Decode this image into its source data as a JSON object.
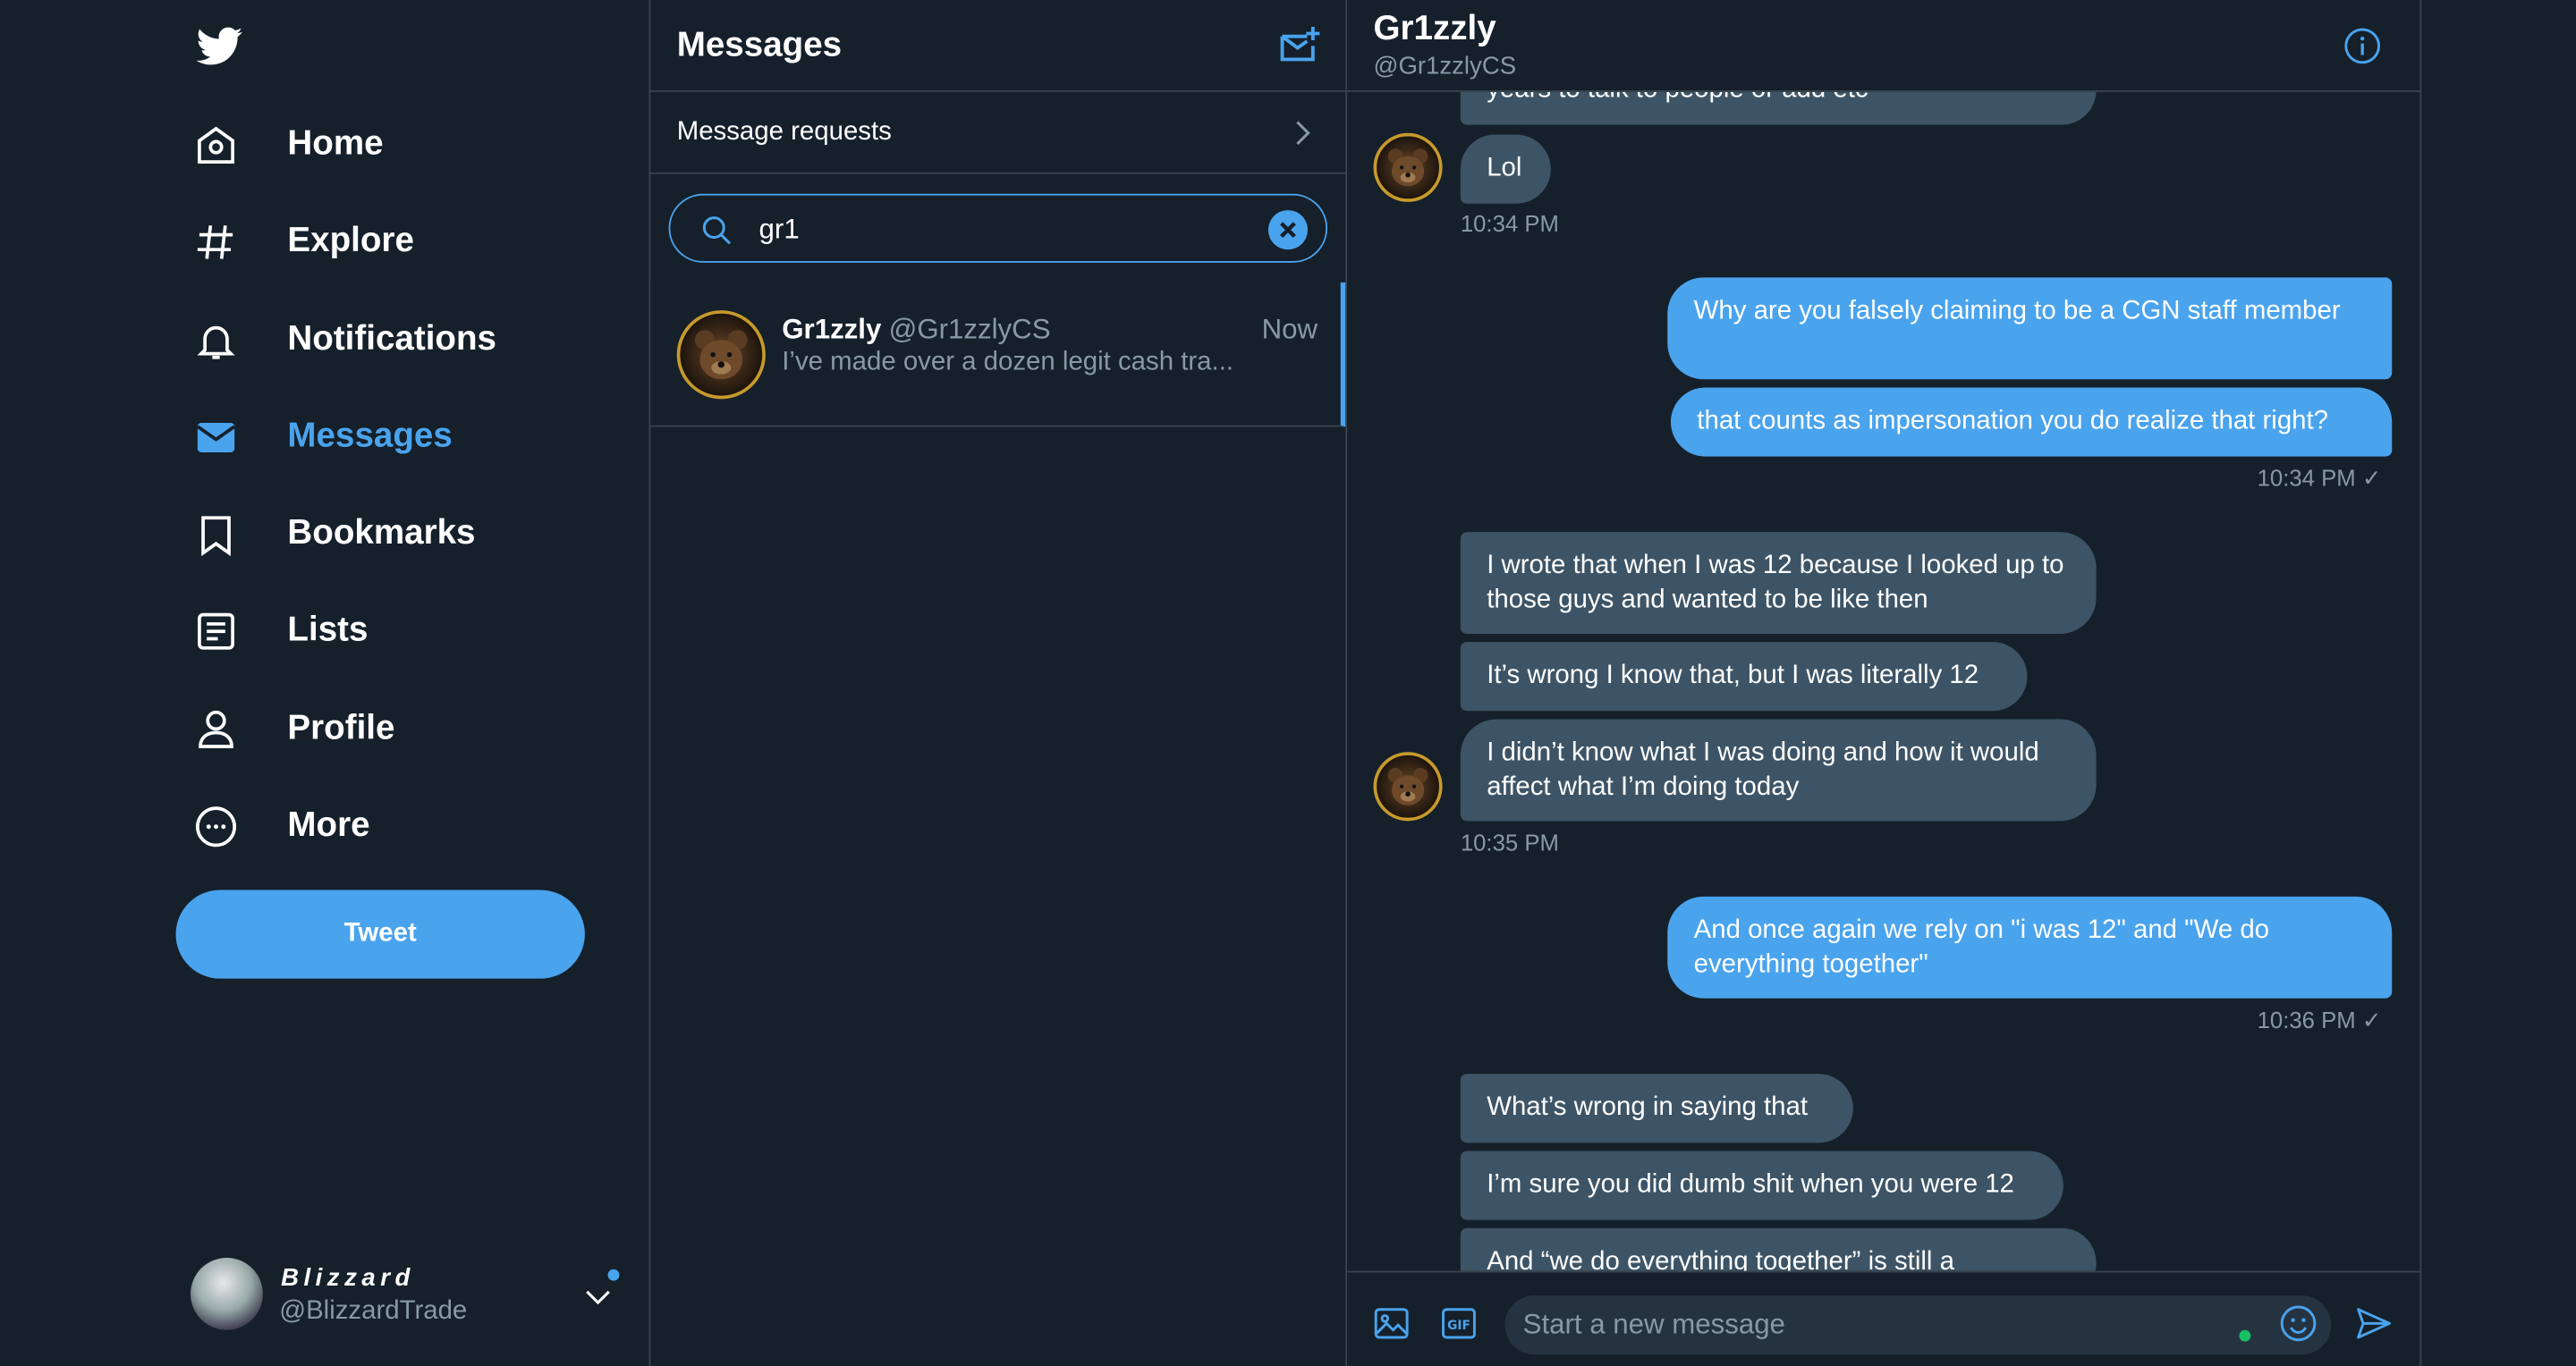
{
  "nav": {
    "items": [
      {
        "label": "Home",
        "icon": "home-icon"
      },
      {
        "label": "Explore",
        "icon": "hashtag-icon"
      },
      {
        "label": "Notifications",
        "icon": "bell-icon"
      },
      {
        "label": "Messages",
        "icon": "envelope-icon",
        "active": true
      },
      {
        "label": "Bookmarks",
        "icon": "bookmark-icon"
      },
      {
        "label": "Lists",
        "icon": "list-icon"
      },
      {
        "label": "Profile",
        "icon": "person-icon"
      },
      {
        "label": "More",
        "icon": "more-icon"
      }
    ],
    "tweet_label": "Tweet",
    "accent": "#4aa3ed"
  },
  "account": {
    "name": "Blizzard",
    "handle": "@BlizzardTrade"
  },
  "messages": {
    "title": "Messages",
    "requests_label": "Message requests",
    "search_value": "gr1",
    "conversation": {
      "name": "Gr1zzly",
      "handle": "@Gr1zzlyCS",
      "time": "Now",
      "preview": "I’ve made over a dozen legit cash tra..."
    }
  },
  "chat": {
    "name": "Gr1zzly",
    "handle": "@Gr1zzlyCS",
    "cut_top": "years to talk to people or add etc",
    "msg_lol": "Lol",
    "ts1": "10:34 PM",
    "out1a": "Why are you falsely claiming to be a CGN staff member",
    "out1b": "that counts as impersonation you do realize that right?",
    "ts2": "10:34 PM ✓",
    "in2a": "I wrote that when I was 12 because I looked up to those guys and wanted to be like then",
    "in2b": "It’s wrong I know that, but I was literally 12",
    "in2c": "I didn’t know what I was doing and how it would affect what I’m doing today",
    "ts3": "10:35 PM",
    "out2": "And once again we rely on \"i was 12\" and \"We do everything together\"",
    "ts4": "10:36 PM ✓",
    "in3a": "What’s wrong in saying that",
    "in3b": "I’m sure you did dumb shit when you were 12",
    "in3c": "And “we do everything together” is still a",
    "composer_placeholder": "Start a new message"
  }
}
